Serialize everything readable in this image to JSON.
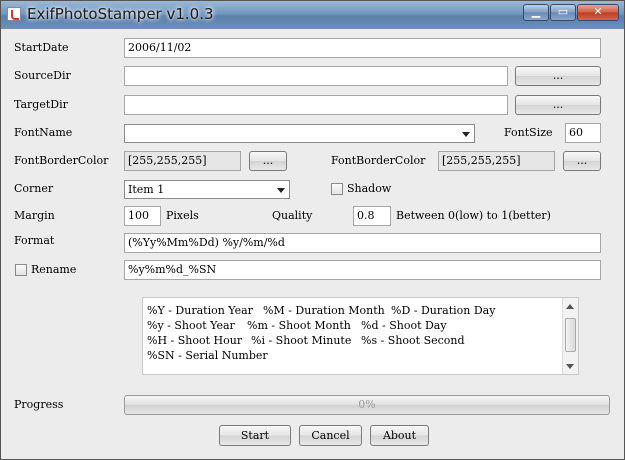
{
  "window": {
    "title": "ExifPhotoStamper v1.0.3"
  },
  "form": {
    "start_date": {
      "label": "StartDate",
      "value": "2006/11/02"
    },
    "source_dir": {
      "label": "SourceDir",
      "value": "",
      "browse_label": "..."
    },
    "target_dir": {
      "label": "TargetDir",
      "value": "",
      "browse_label": "..."
    },
    "font_name": {
      "label": "FontName",
      "value": ""
    },
    "font_size": {
      "label": "FontSize",
      "value": "60"
    },
    "font_border_color": {
      "label": "FontBorderColor",
      "value": "[255,255,255]",
      "button_label": "..."
    },
    "font_border_color_2": {
      "label": "FontBorderColor",
      "value": "[255,255,255]",
      "button_label": "..."
    },
    "corner": {
      "label": "Corner",
      "value": "Item 1"
    },
    "shadow": {
      "label": "Shadow",
      "checked": false
    },
    "margin": {
      "label": "Margin",
      "value": "100",
      "unit": "Pixels"
    },
    "quality": {
      "label": "Quality",
      "value": "0.8",
      "hint": "Between 0(low) to 1(better)"
    },
    "format": {
      "label": "Format",
      "value": "(%Yy%Mm%Dd) %y/%m/%d"
    },
    "rename": {
      "label": "Rename",
      "checked": false,
      "value": "%y%m%d_%SN"
    }
  },
  "help_text": [
    [
      "%Y - Duration Year",
      "%M - Duration Month",
      "%D - Duration Day"
    ],
    [
      "%y - Shoot Year",
      "%m - Shoot Month",
      "%d - Shoot Day"
    ],
    [
      "%H - Shoot Hour",
      "%i - Shoot Minute",
      "%s - Shoot Second"
    ],
    [
      "%SN - Serial Number"
    ]
  ],
  "progress": {
    "label": "Progress",
    "value": 0,
    "text": "0%"
  },
  "buttons": {
    "start": "Start",
    "cancel": "Cancel",
    "about": "About"
  },
  "colors": {
    "titlebar": "#7397bf",
    "close": "#cc5f45"
  }
}
